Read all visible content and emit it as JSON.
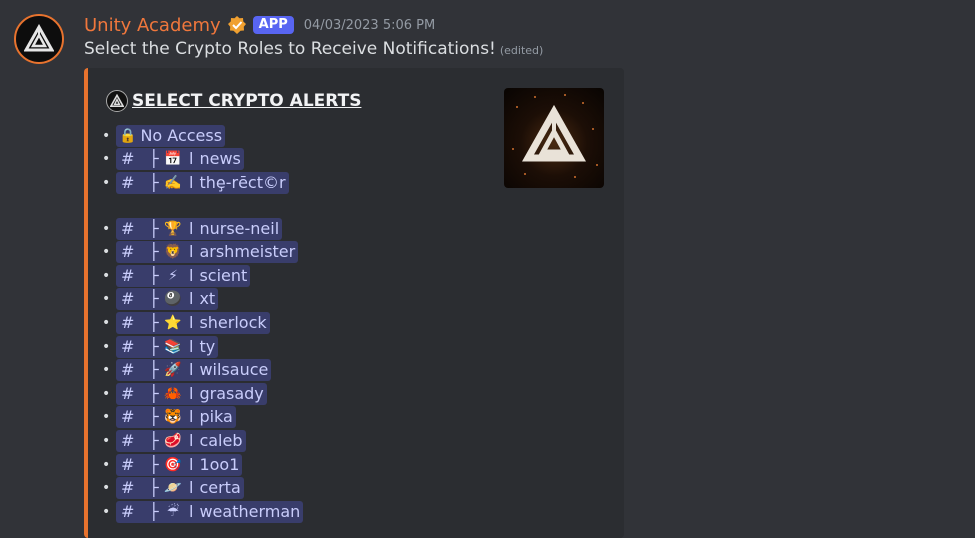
{
  "author": {
    "name": "Unity Academy",
    "badge": "APP",
    "timestamp": "04/03/2023 5:06 PM",
    "verified_icon": "verified-badge-icon"
  },
  "message": {
    "text": "Select the Crypto Roles to Receive Notifications!",
    "edited_label": "(edited)"
  },
  "embed": {
    "accent_color": "#e8732e",
    "title": "SELECT CRYPTO ALERTS",
    "items": [
      {
        "kind": "plain",
        "label": "No Access",
        "icon": "lock-icon",
        "glyph": "🔒"
      },
      {
        "kind": "channel",
        "hash": "#",
        "tree": "├",
        "emoji": "📅",
        "pipe": "l",
        "label": "news"
      },
      {
        "kind": "channel",
        "hash": "#",
        "tree": "├",
        "emoji": "✍️",
        "pipe": "l",
        "label": "thȩ-rēct©r"
      },
      {
        "kind": "channel",
        "hash": "#",
        "tree": "├",
        "emoji": "🏆",
        "pipe": "l",
        "label": "nurse-neil",
        "gap": true
      },
      {
        "kind": "channel",
        "hash": "#",
        "tree": "├",
        "emoji": "🦁",
        "pipe": "l",
        "label": "arshmeister"
      },
      {
        "kind": "channel",
        "hash": "#",
        "tree": "├",
        "emoji": "⚡",
        "pipe": "l",
        "label": "scient"
      },
      {
        "kind": "channel",
        "hash": "#",
        "tree": "├",
        "emoji": "🎱",
        "pipe": "l",
        "label": "xt"
      },
      {
        "kind": "channel",
        "hash": "#",
        "tree": "├",
        "emoji": "⭐",
        "pipe": "l",
        "label": "sherlock"
      },
      {
        "kind": "channel",
        "hash": "#",
        "tree": "├",
        "emoji": "📚",
        "pipe": "l",
        "label": "ty"
      },
      {
        "kind": "channel",
        "hash": "#",
        "tree": "├",
        "emoji": "🚀",
        "pipe": "l",
        "label": "wilsauce"
      },
      {
        "kind": "channel",
        "hash": "#",
        "tree": "├",
        "emoji": "🦀",
        "pipe": "l",
        "label": "grasady"
      },
      {
        "kind": "channel",
        "hash": "#",
        "tree": "├",
        "emoji": "🐯",
        "pipe": "l",
        "label": "pika"
      },
      {
        "kind": "channel",
        "hash": "#",
        "tree": "├",
        "emoji": "🥩",
        "pipe": "l",
        "label": "caleb"
      },
      {
        "kind": "channel",
        "hash": "#",
        "tree": "├",
        "emoji": "🎯",
        "pipe": "l",
        "label": "1oo1"
      },
      {
        "kind": "channel",
        "hash": "#",
        "tree": "├",
        "emoji": "🪐",
        "pipe": "l",
        "label": "certa"
      },
      {
        "kind": "channel",
        "hash": "#",
        "tree": "├",
        "emoji": "☔",
        "pipe": "l",
        "label": "weatherman"
      }
    ]
  }
}
